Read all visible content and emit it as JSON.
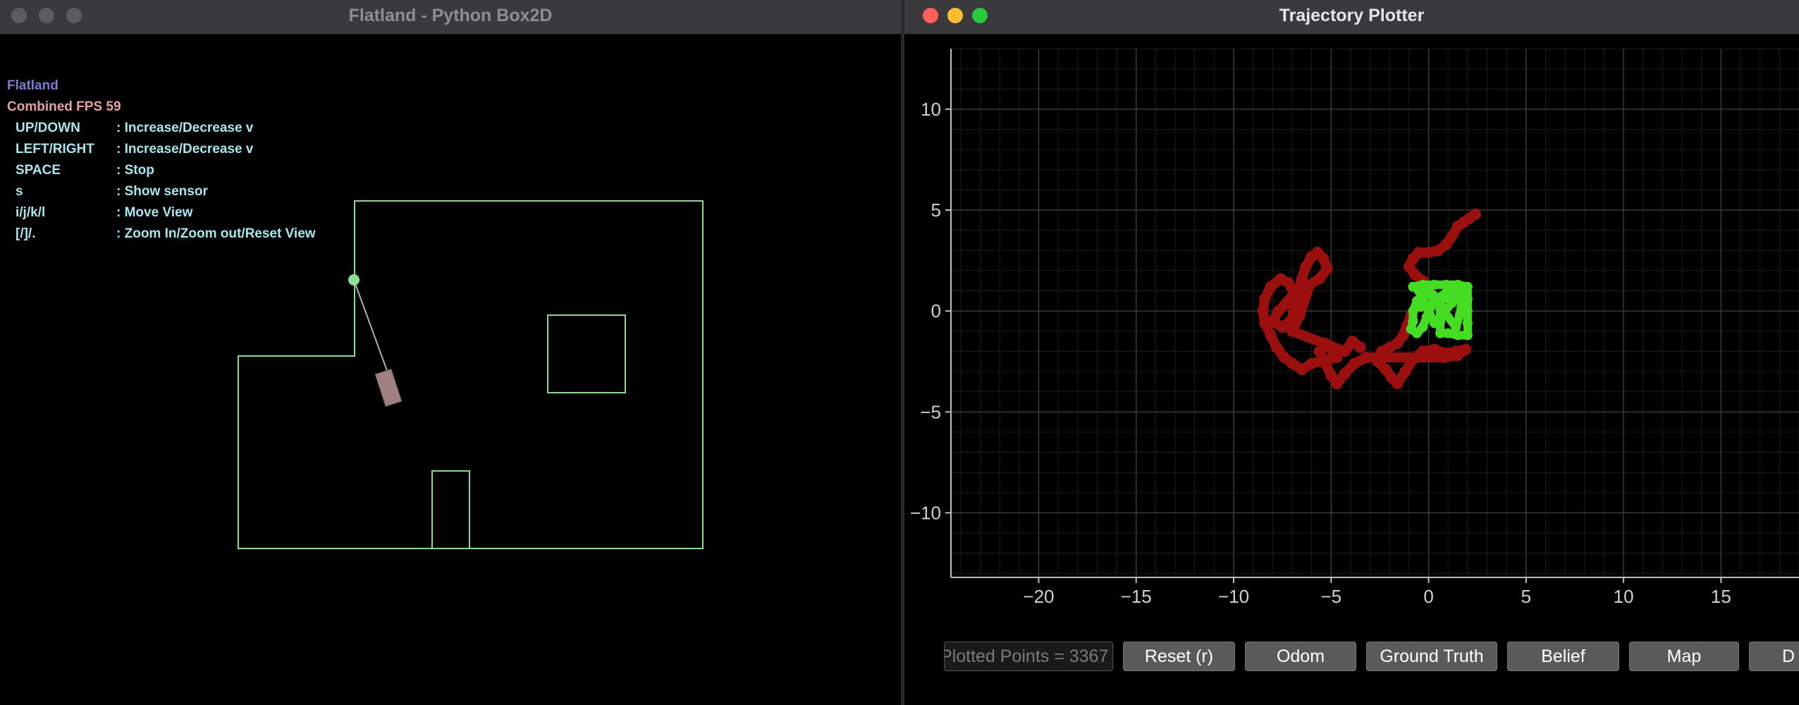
{
  "left_window": {
    "title": "Flatland - Python Box2D",
    "hud": {
      "app_name": "Flatland",
      "fps_label": "Combined FPS 59",
      "controls": [
        {
          "key": "UP/DOWN",
          "desc": ": Increase/Decrease v"
        },
        {
          "key": "LEFT/RIGHT",
          "desc": ": Increase/Decrease v"
        },
        {
          "key": "SPACE",
          "desc": ": Stop"
        },
        {
          "key": "s",
          "desc": ": Show sensor"
        },
        {
          "key": "i/j/k/l",
          "desc": ": Move View"
        },
        {
          "key": "[/]/.",
          "desc": ": Zoom In/Zoom out/Reset View"
        }
      ],
      "colors": {
        "app_name": "#7b7bd6",
        "fps": "#e8a0a0",
        "controls": "#a8e6ee"
      }
    },
    "scene_colors": {
      "walls": "#8fd98f",
      "robot": "#a08080",
      "sensor_point": "#8fe08f",
      "sensor_ray": "#b0b0b0"
    }
  },
  "right_window": {
    "title": "Trajectory Plotter",
    "counter_text": "Plotted Points = 3367",
    "buttons": [
      {
        "id": "reset",
        "label": "Reset (r)"
      },
      {
        "id": "odom",
        "label": "Odom"
      },
      {
        "id": "ground_truth",
        "label": "Ground Truth"
      },
      {
        "id": "belief",
        "label": "Belief"
      },
      {
        "id": "map",
        "label": "Map"
      },
      {
        "id": "d",
        "label": "D"
      }
    ]
  },
  "chart_data": {
    "type": "scatter",
    "title": "",
    "xlabel": "",
    "ylabel": "",
    "xlim": [
      -24.5,
      19.0
    ],
    "ylim": [
      -13.2,
      13.0
    ],
    "xticks": [
      -20,
      -15,
      -10,
      -5,
      0,
      5,
      10,
      15
    ],
    "yticks": [
      10,
      5,
      0,
      -5,
      -10
    ],
    "grid": true,
    "series": [
      {
        "color": "#9b0f0f",
        "points": [
          [
            2.4,
            4.8
          ],
          [
            2.1,
            4.6
          ],
          [
            1.8,
            4.4
          ],
          [
            1.5,
            4.2
          ],
          [
            1.2,
            3.7
          ],
          [
            0.9,
            3.3
          ],
          [
            0.5,
            3.0
          ],
          [
            0.0,
            2.9
          ],
          [
            -0.5,
            2.9
          ],
          [
            -0.8,
            2.6
          ],
          [
            -1.0,
            2.2
          ],
          [
            -0.7,
            1.8
          ],
          [
            -0.3,
            1.5
          ],
          [
            0.1,
            1.1
          ],
          [
            -0.2,
            0.6
          ],
          [
            -0.6,
            0.3
          ],
          [
            -0.9,
            -0.2
          ],
          [
            -1.1,
            -0.7
          ],
          [
            -1.3,
            -1.2
          ],
          [
            -1.6,
            -1.6
          ],
          [
            -2.0,
            -1.8
          ],
          [
            -2.4,
            -2.0
          ],
          [
            -2.6,
            -2.5
          ],
          [
            -2.2,
            -2.9
          ],
          [
            -1.9,
            -3.3
          ],
          [
            -1.6,
            -3.6
          ],
          [
            -1.2,
            -3.0
          ],
          [
            -0.8,
            -2.4
          ],
          [
            -0.3,
            -2.0
          ],
          [
            0.3,
            -1.9
          ],
          [
            0.9,
            -2.1
          ],
          [
            1.4,
            -2.0
          ],
          [
            1.9,
            -1.9
          ],
          [
            1.5,
            -2.2
          ],
          [
            0.8,
            -2.3
          ],
          [
            -3.2,
            -2.3
          ],
          [
            -3.8,
            -2.6
          ],
          [
            -4.3,
            -3.1
          ],
          [
            -4.7,
            -3.6
          ],
          [
            -5.0,
            -3.2
          ],
          [
            -5.3,
            -2.6
          ],
          [
            -5.6,
            -2.0
          ],
          [
            -5.3,
            -1.6
          ],
          [
            -5.0,
            -1.9
          ],
          [
            -4.7,
            -2.3
          ],
          [
            -6.0,
            -2.6
          ],
          [
            -6.5,
            -2.9
          ],
          [
            -7.0,
            -2.6
          ],
          [
            -7.4,
            -2.3
          ],
          [
            -7.8,
            -1.8
          ],
          [
            -8.1,
            -1.2
          ],
          [
            -8.4,
            -0.6
          ],
          [
            -8.5,
            0.0
          ],
          [
            -8.4,
            0.6
          ],
          [
            -8.1,
            1.2
          ],
          [
            -7.6,
            1.6
          ],
          [
            -7.2,
            1.4
          ],
          [
            -6.9,
            0.9
          ],
          [
            -7.3,
            0.4
          ],
          [
            -7.7,
            0.0
          ],
          [
            -8.0,
            -0.5
          ],
          [
            -7.5,
            -0.8
          ],
          [
            -7.0,
            -0.4
          ],
          [
            -6.9,
            0.3
          ],
          [
            -6.7,
            1.0
          ],
          [
            -6.5,
            1.6
          ],
          [
            -6.3,
            2.2
          ],
          [
            -6.0,
            2.7
          ],
          [
            -5.7,
            2.9
          ],
          [
            -5.4,
            2.6
          ],
          [
            -5.2,
            2.1
          ],
          [
            -5.6,
            1.6
          ],
          [
            -6.1,
            1.3
          ],
          [
            -6.6,
            -0.2
          ],
          [
            -7.0,
            -1.0
          ],
          [
            -4.3,
            -2.0
          ],
          [
            -3.9,
            -1.5
          ],
          [
            -3.5,
            -1.8
          ]
        ],
        "marker": "circle"
      },
      {
        "color": "#44dd22",
        "points": [
          [
            -0.8,
            1.2
          ],
          [
            -0.3,
            1.3
          ],
          [
            0.3,
            1.3
          ],
          [
            0.9,
            1.3
          ],
          [
            1.5,
            1.3
          ],
          [
            2.0,
            1.2
          ],
          [
            2.0,
            0.6
          ],
          [
            2.0,
            0.0
          ],
          [
            2.0,
            -0.6
          ],
          [
            2.0,
            -1.2
          ],
          [
            1.5,
            -1.2
          ],
          [
            1.0,
            -1.1
          ],
          [
            0.6,
            -1.1
          ],
          [
            0.6,
            -0.5
          ],
          [
            0.6,
            0.1
          ],
          [
            0.6,
            0.6
          ],
          [
            0.2,
            0.8
          ],
          [
            -0.3,
            0.8
          ],
          [
            -0.6,
            0.5
          ],
          [
            -0.8,
            0.0
          ],
          [
            -0.8,
            -0.5
          ],
          [
            -0.9,
            -0.9
          ],
          [
            -0.6,
            -1.1
          ],
          [
            -0.3,
            -0.8
          ],
          [
            -0.1,
            -0.3
          ],
          [
            0.1,
            0.2
          ],
          [
            0.4,
            0.6
          ],
          [
            0.9,
            0.9
          ],
          [
            1.4,
            0.9
          ],
          [
            1.7,
            0.5
          ],
          [
            1.6,
            -0.2
          ],
          [
            1.4,
            -0.8
          ],
          [
            0.0,
            1.0
          ],
          [
            -0.5,
            1.0
          ],
          [
            0.3,
            -0.6
          ],
          [
            1.2,
            0.4
          ],
          [
            1.8,
            0.9
          ],
          [
            -0.4,
            0.2
          ]
        ],
        "marker": "circle"
      }
    ]
  }
}
